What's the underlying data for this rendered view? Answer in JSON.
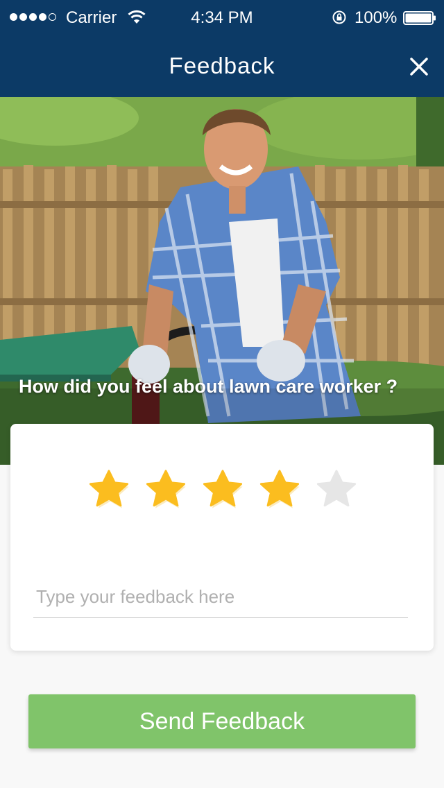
{
  "status_bar": {
    "carrier": "Carrier",
    "time": "4:34 PM",
    "battery": "100%",
    "signal_strength": 4,
    "signal_max": 5
  },
  "header": {
    "title": "Feedback",
    "close_icon": "close-icon"
  },
  "hero": {
    "question": "How did you feel about lawn care worker ?"
  },
  "rating": {
    "value": 4,
    "max": 5,
    "filled_color": "#fbbd1f",
    "empty_color": "#e6e6e6"
  },
  "feedback": {
    "placeholder": "Type your feedback here",
    "value": ""
  },
  "actions": {
    "send_label": "Send Feedback"
  },
  "colors": {
    "header_bg": "#0c3a66",
    "button_bg": "#80c46a"
  }
}
